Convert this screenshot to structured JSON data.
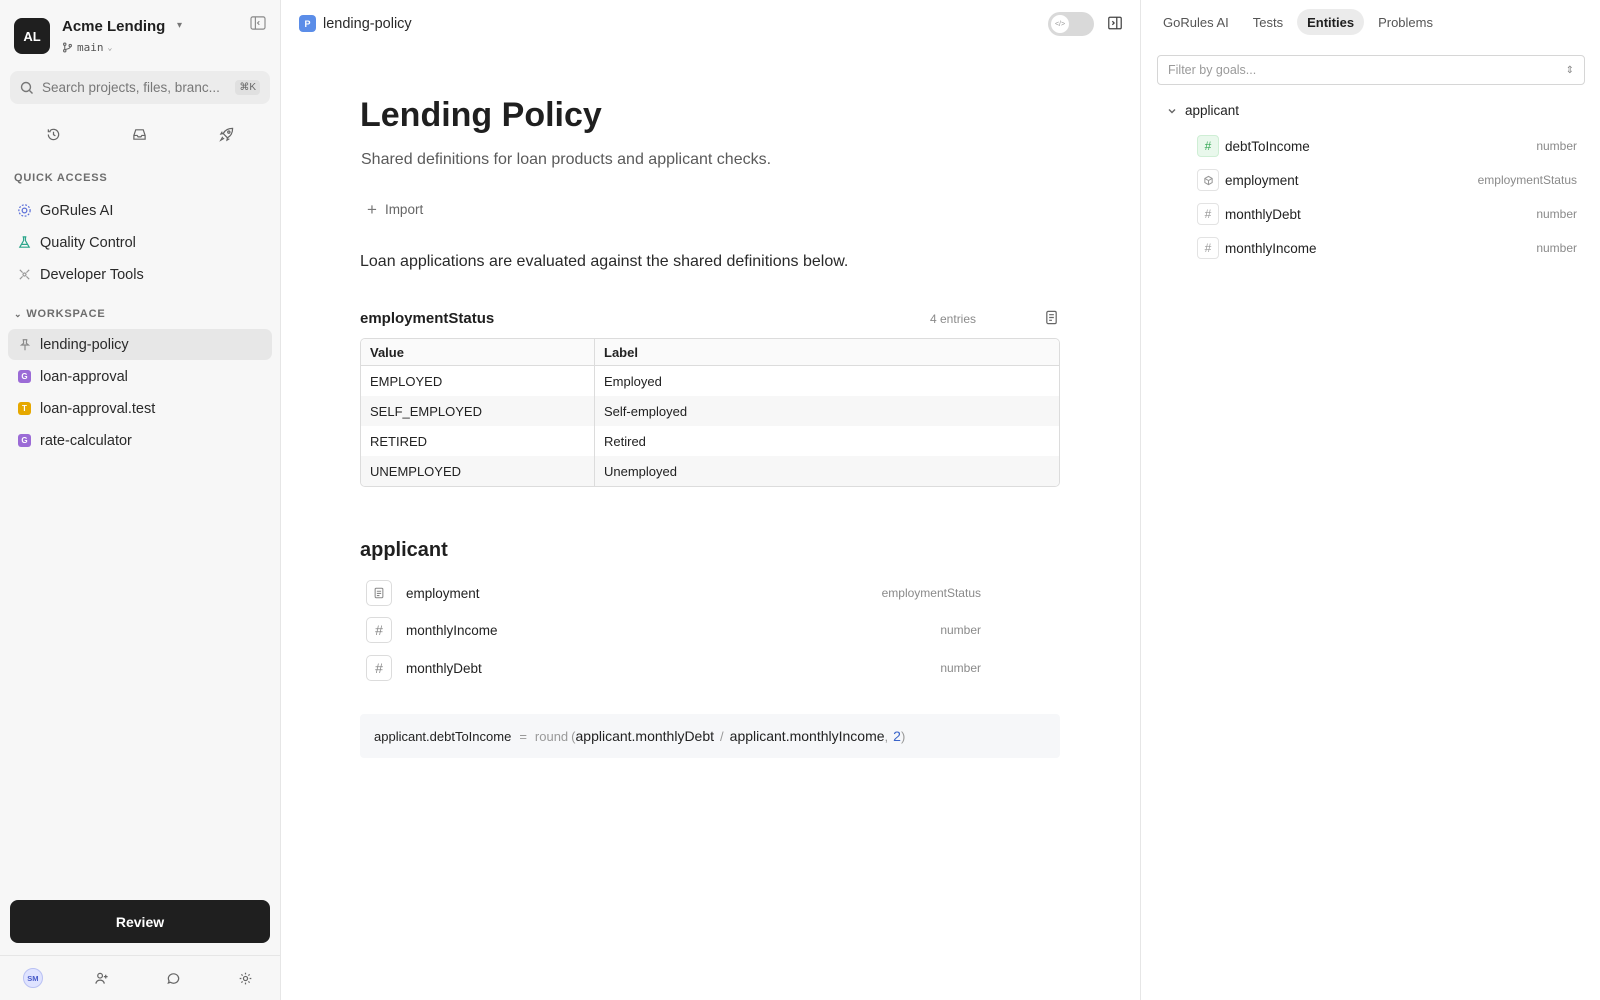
{
  "sidebar": {
    "org_initials": "AL",
    "org_name": "Acme Lending",
    "branch": "main",
    "search_placeholder": "Search projects, files, branc...",
    "search_shortcut": "⌘K",
    "quick_access_label": "QUICK ACCESS",
    "quick_access": [
      {
        "label": "GoRules AI",
        "icon": "ai-gear-icon"
      },
      {
        "label": "Quality Control",
        "icon": "flask-icon"
      },
      {
        "label": "Developer Tools",
        "icon": "tools-icon"
      }
    ],
    "workspace_label": "WORKSPACE",
    "workspace": [
      {
        "label": "lending-policy",
        "icon": "pin-icon",
        "active": true
      },
      {
        "label": "loan-approval",
        "badge": "G"
      },
      {
        "label": "loan-approval.test",
        "badge": "T"
      },
      {
        "label": "rate-calculator",
        "badge": "G"
      }
    ],
    "review_label": "Review",
    "user_initials": "SM"
  },
  "topbar": {
    "file_badge": "P",
    "file_name": "lending-policy"
  },
  "document": {
    "title": "Lending Policy",
    "subtitle": "Shared definitions for loan products and applicant checks.",
    "import_label": "Import",
    "intro": "Loan applications are evaluated against the shared definitions below."
  },
  "enum": {
    "name": "employmentStatus",
    "count": "4 entries",
    "columns": [
      "Value",
      "Label"
    ],
    "rows": [
      [
        "EMPLOYED",
        "Employed"
      ],
      [
        "SELF_EMPLOYED",
        "Self-employed"
      ],
      [
        "RETIRED",
        "Retired"
      ],
      [
        "UNEMPLOYED",
        "Unemployed"
      ]
    ]
  },
  "entity": {
    "name": "applicant",
    "attributes": [
      {
        "name": "employment",
        "type": "employmentStatus",
        "icon": "doc-icon"
      },
      {
        "name": "monthlyIncome",
        "type": "number",
        "icon": "hash-icon"
      },
      {
        "name": "monthlyDebt",
        "type": "number",
        "icon": "hash-icon"
      }
    ],
    "formula": {
      "target": "applicant.debtToIncome",
      "equals": "=",
      "fn": "round",
      "open_paren": "(",
      "arg1": "applicant.monthlyDebt",
      "div": "/",
      "arg2": "applicant.monthlyIncome",
      "comma": ",",
      "precision": "2",
      "close_paren": ")"
    }
  },
  "right_panel": {
    "tabs": [
      "GoRules AI",
      "Tests",
      "Entities",
      "Problems"
    ],
    "active_tab": "Entities",
    "filter_placeholder": "Filter by goals...",
    "tree_root": "applicant",
    "tree_items": [
      {
        "name": "debtToIncome",
        "type": "number",
        "icon": "hash-icon",
        "color": "#36a855"
      },
      {
        "name": "employment",
        "type": "employmentStatus",
        "icon": "enum-icon"
      },
      {
        "name": "monthlyDebt",
        "type": "number",
        "icon": "hash-icon"
      },
      {
        "name": "monthlyIncome",
        "type": "number",
        "icon": "hash-icon"
      }
    ]
  }
}
